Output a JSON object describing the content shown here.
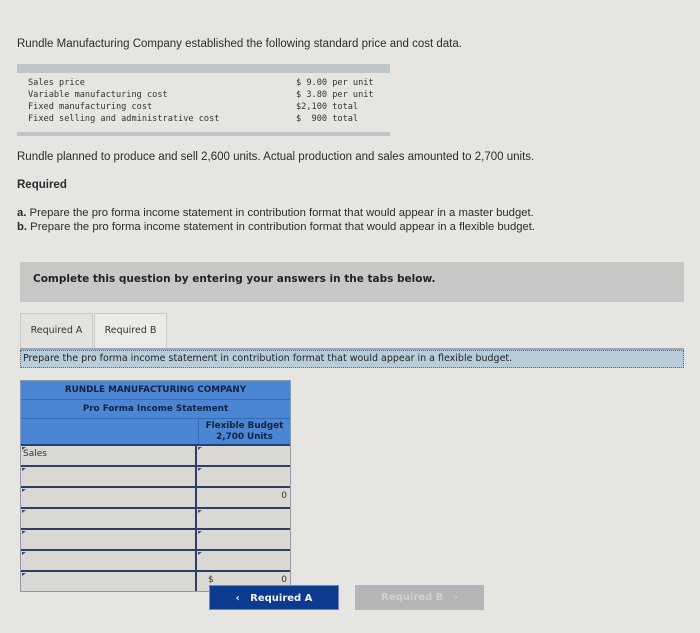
{
  "intro": "Rundle Manufacturing Company established the following standard price and cost data.",
  "cost_data": [
    {
      "label": "Sales price",
      "value": "$ 9.00 per unit"
    },
    {
      "label": "Variable manufacturing cost",
      "value": "$ 3.80 per unit"
    },
    {
      "label": "Fixed manufacturing cost",
      "value": "$2,100 total"
    },
    {
      "label": "Fixed selling and administrative cost",
      "value": "$  900 total"
    }
  ],
  "planned_text": "Rundle planned to produce and sell 2,600 units. Actual production and sales amounted to 2,700 units.",
  "required_heading": "Required",
  "requirements": [
    {
      "letter": "a.",
      "text": " Prepare the pro forma income statement in contribution format that would appear in a master budget."
    },
    {
      "letter": "b.",
      "text": " Prepare the pro forma income statement in contribution format that would appear in a flexible budget."
    }
  ],
  "banner": "Complete this question by entering your answers in the tabs below.",
  "tabs": [
    {
      "label": "Required A",
      "active": false
    },
    {
      "label": "Required B",
      "active": true
    }
  ],
  "instruction": "Prepare the pro forma income statement in contribution format that would appear in a flexible budget.",
  "statement": {
    "company": "RUNDLE MANUFACTURING COMPANY",
    "title": "Pro Forma Income Statement",
    "column_header_line1": "Flexible Budget",
    "column_header_line2": "2,700 Units",
    "rows": [
      {
        "label": "Sales",
        "value": ""
      },
      {
        "label": "",
        "value": ""
      },
      {
        "label": "",
        "value": "0"
      },
      {
        "label": "",
        "value": ""
      },
      {
        "label": "",
        "value": ""
      },
      {
        "label": "",
        "value": ""
      },
      {
        "label": "",
        "value": "0",
        "currency": "$"
      }
    ]
  },
  "nav": {
    "prev_label": "Required A",
    "next_label": "Required B"
  }
}
